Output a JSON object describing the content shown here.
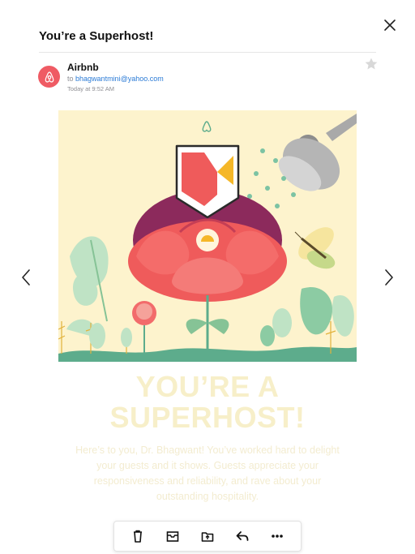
{
  "email": {
    "subject": "You’re a Superhost!",
    "sender": "Airbnb",
    "to_prefix": "to",
    "recipient": "bhagwantmini@yahoo.com",
    "time": "Today at 9:52 AM"
  },
  "content": {
    "headline_line1": "YOU’RE A",
    "headline_line2": "SUPERHOST!",
    "body": "Here’s to you, Dr. Bhagwant! You’ve worked hard to delight your guests and it shows. Guests appreciate your responsiveness and reliability, and rave about your outstanding hospitality."
  },
  "icons": {
    "close": "close-icon",
    "star": "star-icon",
    "avatar": "airbnb-logo-icon",
    "prev": "chevron-left-icon",
    "next": "chevron-right-icon",
    "toolbar": [
      "trash-icon",
      "mailbox-icon",
      "move-folder-icon",
      "reply-icon",
      "more-icon"
    ]
  },
  "colors": {
    "brand": "#ef5b64",
    "cream": "#fdf3cd",
    "green": "#5dac8c",
    "link": "#2b7bd6"
  }
}
